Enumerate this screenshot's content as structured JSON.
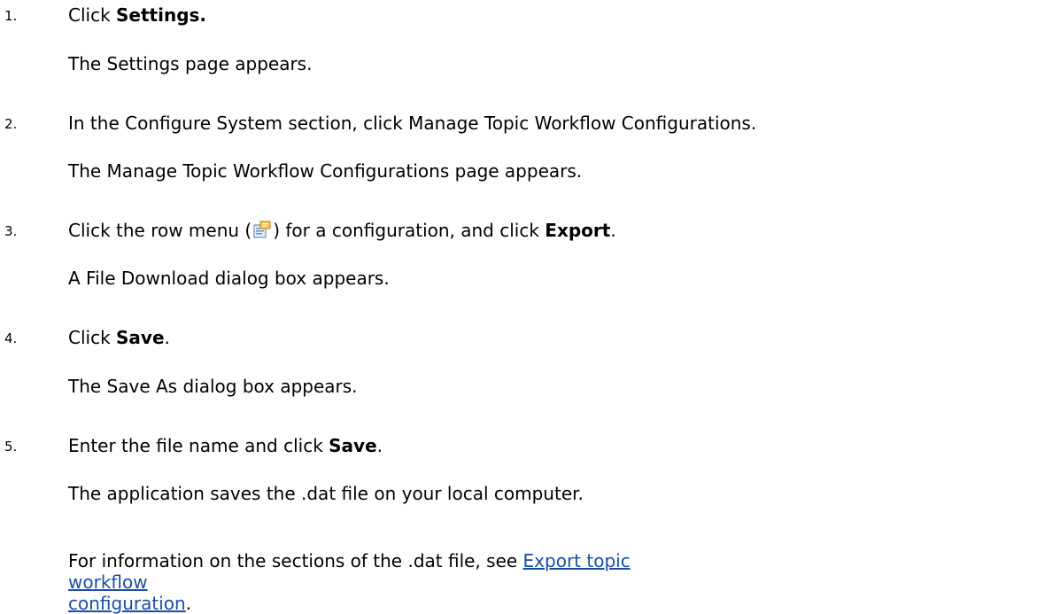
{
  "steps": [
    {
      "number": "1.",
      "action": {
        "pre": "Click ",
        "bold": "Settings.",
        "post": ""
      },
      "result": "The Settings page appears."
    },
    {
      "number": "2.",
      "action": {
        "text": "In the Configure System section, click Manage Topic Workflow Configurations."
      },
      "result": "The Manage Topic Workflow Configurations page appears."
    },
    {
      "number": "3.",
      "action": {
        "pre": "Click the row menu (",
        "icon": "row-menu-icon",
        "mid": ") for a configuration, and click ",
        "bold": "Export",
        "post": "."
      },
      "result": "A File Download dialog box appears."
    },
    {
      "number": "4.",
      "action": {
        "pre": "Click ",
        "bold": "Save",
        "post": "."
      },
      "result": "The Save As dialog box appears."
    },
    {
      "number": "5.",
      "action": {
        "pre": "Enter the file name and click ",
        "bold": "Save",
        "post": "."
      },
      "result": "The application saves the .dat file on your local computer.",
      "note": {
        "pre": "For information on the sections of the .dat file, see ",
        "link_line1": "Export topic workflow",
        "link_line2": "configuration",
        "post": "."
      }
    }
  ]
}
